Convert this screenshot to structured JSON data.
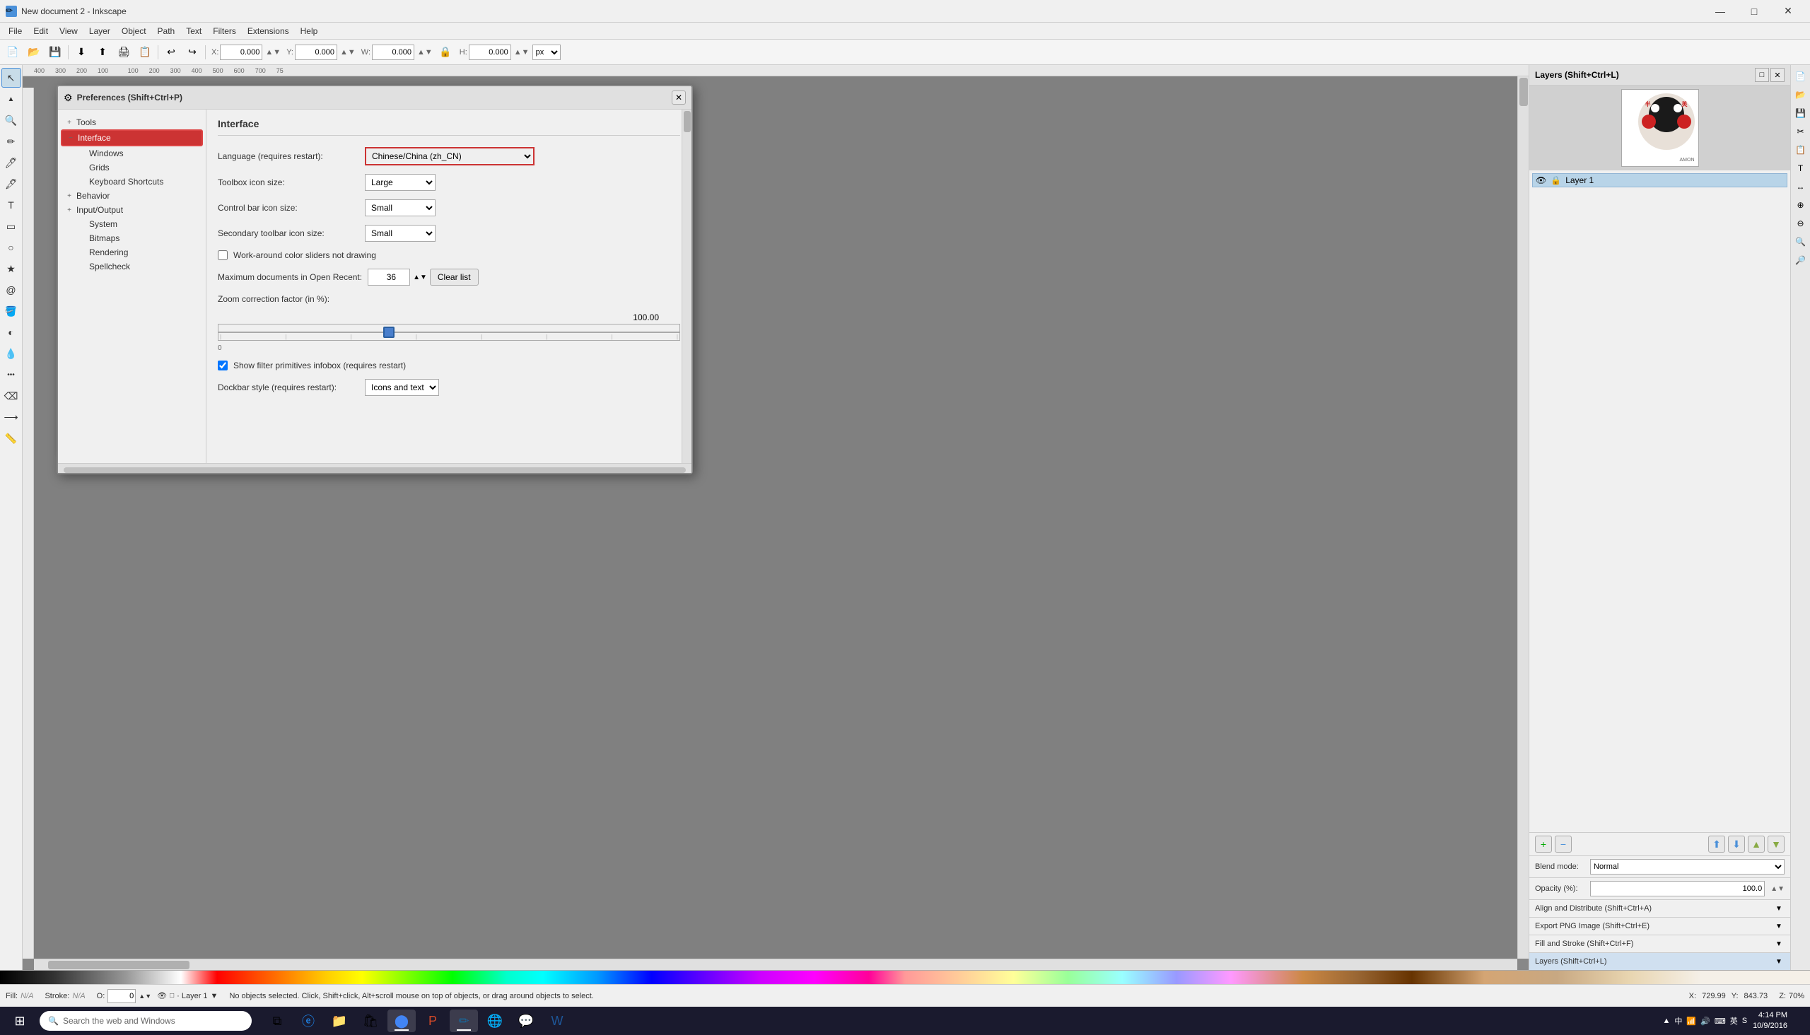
{
  "window": {
    "title": "New document 2 - Inkscape",
    "icon": "✏️"
  },
  "titlebar": {
    "minimize": "—",
    "maximize": "□",
    "close": "✕"
  },
  "menu": {
    "items": [
      "File",
      "Edit",
      "View",
      "Layer",
      "Object",
      "Path",
      "Text",
      "Filters",
      "Extensions",
      "Help"
    ]
  },
  "toolbar": {
    "coords": {
      "x_label": "X:",
      "x_value": "0.000",
      "y_label": "Y:",
      "y_value": "0.000",
      "w_label": "W:",
      "w_value": "0.000",
      "h_label": "H:",
      "h_value": "0.000",
      "unit": "px"
    }
  },
  "dialog": {
    "title": "Preferences (Shift+Ctrl+P)",
    "close_btn": "✕",
    "content_title": "Interface",
    "tree": {
      "tools_label": "Tools",
      "tools_icon": "+",
      "interface_label": "Interface",
      "interface_icon": "−",
      "windows_label": "Windows",
      "grids_label": "Grids",
      "keyboard_label": "Keyboard Shortcuts",
      "behavior_label": "Behavior",
      "behavior_icon": "+",
      "io_label": "Input/Output",
      "io_icon": "+",
      "system_label": "System",
      "bitmaps_label": "Bitmaps",
      "rendering_label": "Rendering",
      "spellcheck_label": "Spellcheck"
    },
    "fields": {
      "language_label": "Language (requires restart):",
      "language_value": "Chinese/China (zh_CN)",
      "toolbox_icon_label": "Toolbox icon size:",
      "toolbox_icon_value": "Large",
      "control_bar_label": "Control bar icon size:",
      "control_bar_value": "Small",
      "secondary_toolbar_label": "Secondary toolbar icon size:",
      "secondary_toolbar_value": "Small",
      "workaround_label": "Work-around color sliders not drawing",
      "workaround_checked": false,
      "max_docs_label": "Maximum documents in Open Recent:",
      "max_docs_value": "36",
      "clear_list_btn": "Clear list",
      "zoom_label": "Zoom correction factor (in %):",
      "zoom_value": "100.00",
      "zoom_min": "0",
      "show_filter_label": "Show filter primitives infobox (requires restart)",
      "show_filter_checked": true,
      "dockbar_label": "Dockbar style (requires restart):",
      "dockbar_value": "Icons and text"
    }
  },
  "layers_panel": {
    "title": "Layers (Shift+Ctrl+L)",
    "layer_name": "Layer 1",
    "blend_label": "Blend mode:",
    "blend_value": "Normal",
    "opacity_label": "Opacity (%):",
    "opacity_value": "100.0",
    "panels": [
      {
        "label": "Align and Distribute (Shift+Ctrl+A)"
      },
      {
        "label": "Export PNG Image (Shift+Ctrl+E)"
      },
      {
        "label": "Fill and Stroke (Shift+Ctrl+F)"
      },
      {
        "label": "Layers (Shift+Ctrl+L)"
      }
    ]
  },
  "status": {
    "fill_label": "Fill:",
    "fill_value": "N/A",
    "stroke_label": "Stroke:",
    "stroke_value": "N/A",
    "opacity_label": "O:",
    "opacity_value": "0",
    "layer_label": "· Layer 1",
    "message": "No objects selected. Click, Shift+click, Alt+scroll mouse on top of objects, or drag around objects to select.",
    "x_label": "X:",
    "x_value": "729.99",
    "y_label": "Y:",
    "y_value": "843.73",
    "zoom_label": "Z:",
    "zoom_value": "70%"
  },
  "taskbar": {
    "search_placeholder": "Search the web and Windows",
    "time": "4:14 PM",
    "date": "10/9/2016"
  }
}
